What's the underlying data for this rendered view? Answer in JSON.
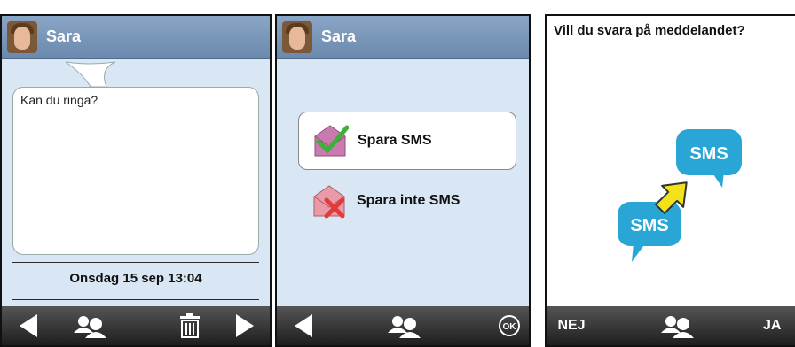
{
  "caption": "",
  "screen1": {
    "contact_name": "Sara",
    "message": "Kan du ringa?",
    "timestamp": "Onsdag 15 sep 13:04",
    "bottom_bar": [
      "back-icon",
      "contacts-icon",
      "trash-icon",
      "forward-icon"
    ]
  },
  "screen2": {
    "contact_name": "Sara",
    "options": [
      {
        "label": "Spara SMS",
        "icon": "save-check-icon",
        "selected": true
      },
      {
        "label": "Spara inte SMS",
        "icon": "save-cross-icon",
        "selected": false
      }
    ],
    "bottom_bar": [
      "back-icon",
      "contacts-icon",
      "ok-icon"
    ]
  },
  "screen3": {
    "question": "Vill du svara på meddelandet?",
    "sms_label_1": "SMS",
    "sms_label_2": "SMS",
    "no_label": "NEJ",
    "yes_label": "JA",
    "bottom_bar": [
      "no-button",
      "contacts-icon",
      "yes-button"
    ]
  },
  "colors": {
    "header": "#7896b8",
    "screen_bg": "#d9e6f4",
    "bottom_bar": "#2a2a2a",
    "sms_bubble": "#2aa6d6",
    "arrow": "#f3e21a"
  }
}
